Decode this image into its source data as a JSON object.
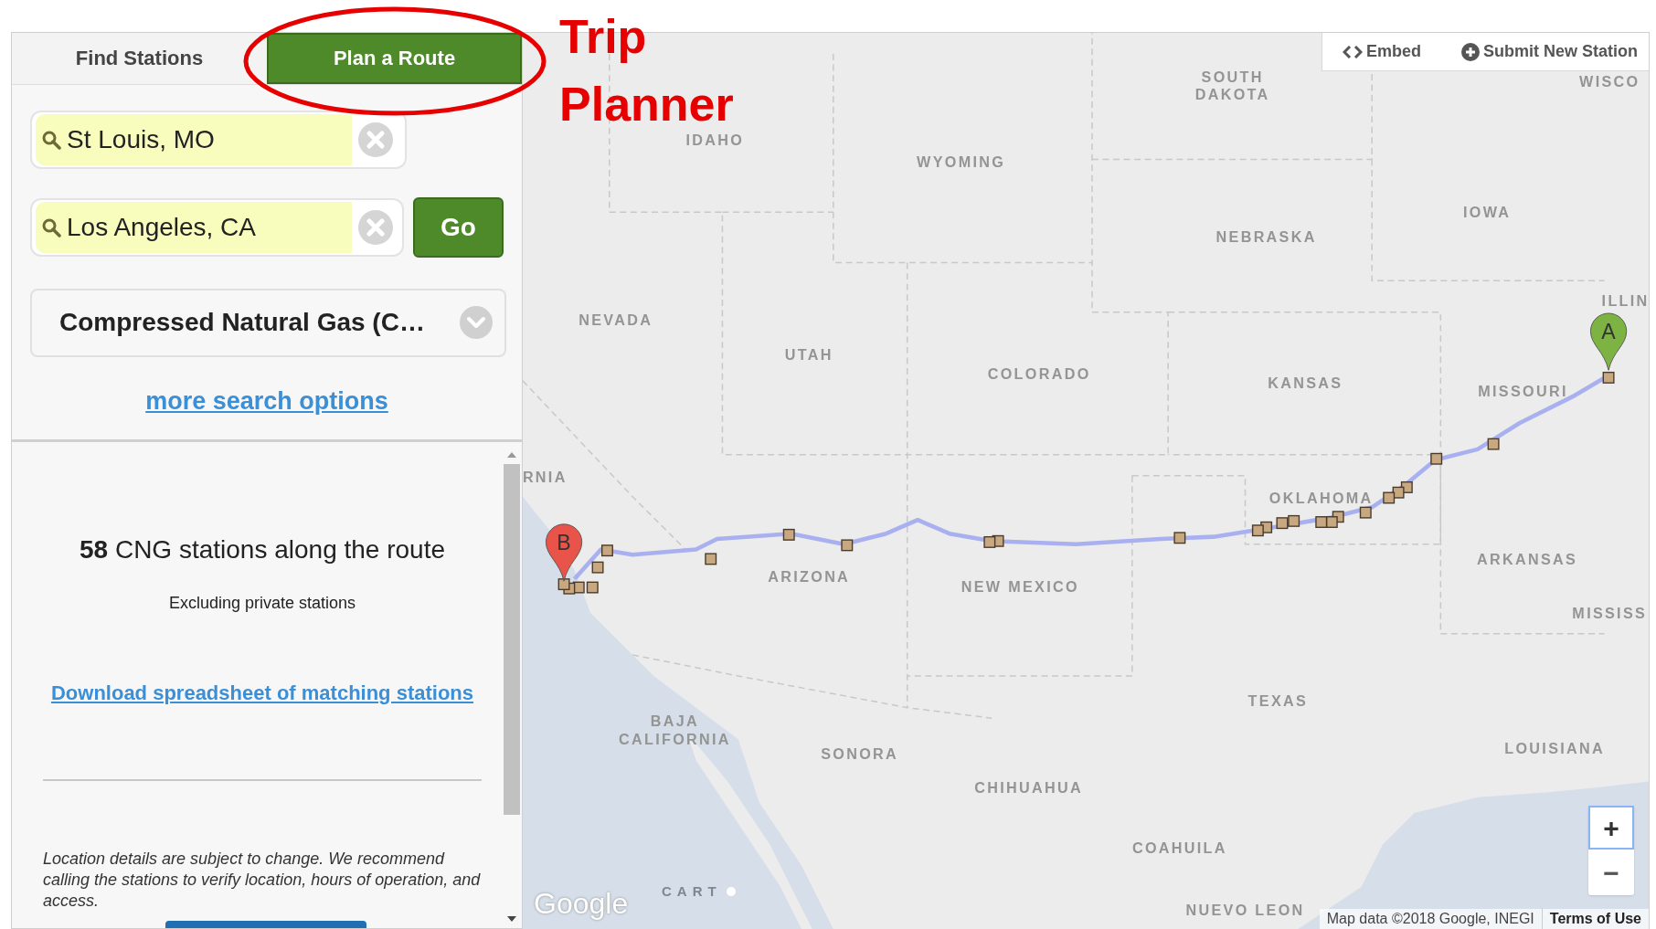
{
  "annotation": {
    "lines": [
      "Trip",
      "Planner"
    ]
  },
  "tabs": [
    {
      "label": "Find Stations",
      "selected": false
    },
    {
      "label": "Plan a Route",
      "selected": true
    }
  ],
  "route_fields": [
    {
      "value": "St Louis, MO"
    },
    {
      "value": "Los Angeles, CA"
    }
  ],
  "go_button": "Go",
  "fuel_select": {
    "value": "Compressed Natural Gas (C…"
  },
  "more_options_link": "more search options",
  "results": {
    "summary": "**58** CNG stations along the route",
    "note": "Excluding private stations",
    "download_link": "Download spreadsheet of matching stations",
    "disclaimer": "Location details are subject to change. We recommend calling the stations to verify location, hours of operation, and access."
  },
  "map": {
    "toolbar": [
      {
        "kind": "embed",
        "label": "Embed"
      },
      {
        "kind": "submit",
        "label": "Submit New Station"
      }
    ],
    "labels": [
      "WISCO",
      "SOUTH",
      "DAKOTA",
      "IDAHO",
      "WYOMING",
      "IOWA",
      "NEBRASKA",
      "ILLIN",
      "NEVADA",
      "UTAH",
      "COLORADO",
      "KANSAS",
      "MISSOURI",
      "RNIA",
      "OKLAHOMA",
      "ARKANSAS",
      "ARIZONA",
      "NEW MEXICO",
      "MISSISS",
      "TEXAS",
      "BAJA",
      "CALIFORNIA",
      "SONORA",
      "CHIHUAHUA",
      "LOUISIANA",
      "COAHUILA",
      "NUEVO LEON"
    ],
    "pins": [
      {
        "letter": "A",
        "color": "#7cb342"
      },
      {
        "letter": "B",
        "color": "#e8534a"
      }
    ],
    "zoom": [
      "+",
      "−"
    ],
    "google_logo": "Google",
    "carto_logo": "CART",
    "attribution": "Map data ©2018 Google, INEGI",
    "terms": "Terms of Use"
  }
}
